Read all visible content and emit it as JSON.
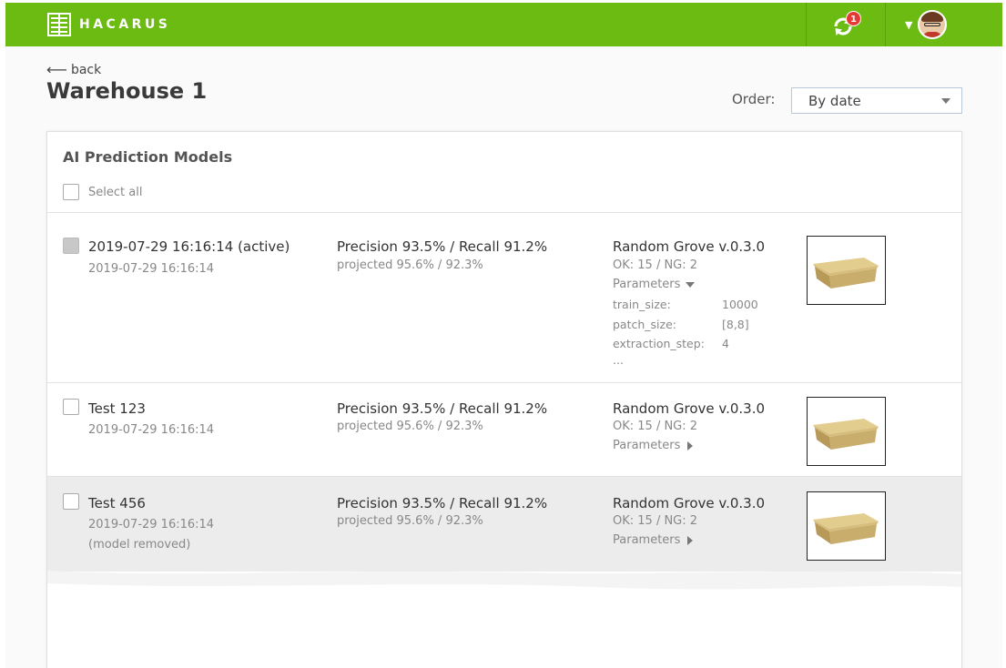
{
  "brand": {
    "name": "HACARUS"
  },
  "topbar": {
    "sync_badge": "1"
  },
  "header": {
    "back_label": "back",
    "title": "Warehouse 1",
    "order_label": "Order:",
    "order_value": "By date"
  },
  "card": {
    "title": "AI Prediction Models",
    "select_all": "Select all"
  },
  "models": [
    {
      "name": "2019-07-29 16:16:14 (active)",
      "date": "2019-07-29 16:16:14",
      "metric": "Precision 93.5% / Recall 91.2%",
      "projected": "projected 95.6% / 92.3%",
      "algorithm": "Random Grove v.0.3.0",
      "okng": "OK: 15 / NG: 2",
      "params_label": "Parameters",
      "params": [
        {
          "key": "train_size:",
          "value": "10000"
        },
        {
          "key": "patch_size:",
          "value": "[8,8]"
        },
        {
          "key": "extraction_step:",
          "value": "4"
        }
      ],
      "params_more": "..."
    },
    {
      "name": "Test 123",
      "date": "2019-07-29 16:16:14",
      "metric": "Precision 93.5% / Recall 91.2%",
      "projected": "projected 95.6% / 92.3%",
      "algorithm": "Random Grove v.0.3.0",
      "okng": "OK: 15 / NG: 2",
      "params_label": "Parameters"
    },
    {
      "name": "Test 456",
      "date": "2019-07-29 16:16:14",
      "note": "(model removed)",
      "metric": "Precision 93.5% / Recall 91.2%",
      "projected": "projected 95.6% / 92.3%",
      "algorithm": "Random Grove v.0.3.0",
      "okng": "OK: 15 / NG: 2",
      "params_label": "Parameters"
    }
  ],
  "colors": {
    "topbar": "#6cbb12",
    "badge": "#e53935",
    "removed_row_bg": "#ececec"
  },
  "icons": [
    "logo-icon",
    "sync-icon",
    "chevron-down-icon",
    "avatar",
    "back-arrow-icon",
    "caret-down-icon",
    "triangle-down-icon",
    "triangle-right-icon",
    "box-thumbnail"
  ]
}
